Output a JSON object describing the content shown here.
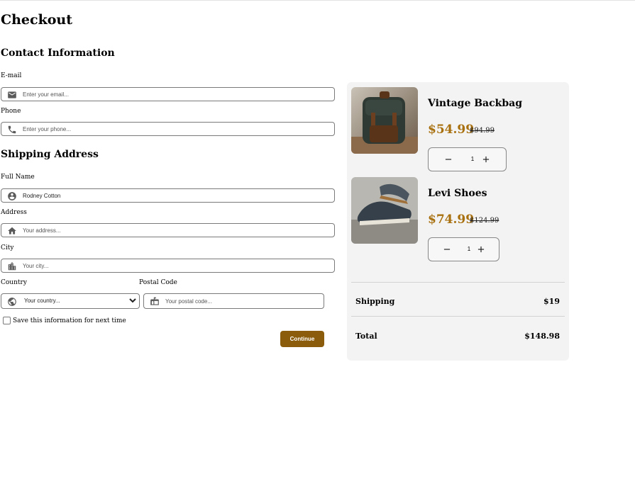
{
  "page": {
    "title": "Checkout"
  },
  "contact": {
    "heading": "Contact Information",
    "email": {
      "label": "E-mail",
      "placeholder": "Enter your email...",
      "value": ""
    },
    "phone": {
      "label": "Phone",
      "placeholder": "Enter your phone...",
      "value": ""
    }
  },
  "shipping": {
    "heading": "Shipping Address",
    "full_name": {
      "label": "Full Name",
      "placeholder": "",
      "value": "Rodney Cotton"
    },
    "address": {
      "label": "Address",
      "placeholder": "Your address...",
      "value": ""
    },
    "city": {
      "label": "City",
      "placeholder": "Your city...",
      "value": ""
    },
    "country": {
      "label": "Country",
      "selected": "Your country..."
    },
    "postal": {
      "label": "Postal Code",
      "placeholder": "Your postal code...",
      "value": ""
    },
    "save_label": "Save this information for next time",
    "continue_label": "Continue"
  },
  "cart": {
    "items": [
      {
        "name": "Vintage Backbag",
        "price": "$54.99",
        "old_price": "$94.99",
        "quantity": "1"
      },
      {
        "name": "Levi Shoes",
        "price": "$74.99",
        "old_price": "$124.99",
        "quantity": "1"
      }
    ],
    "shipping_label": "Shipping",
    "shipping_value": "$19",
    "total_label": "Total",
    "total_value": "$148.98"
  },
  "colors": {
    "accent": "#a8700f",
    "button": "#8a5c0c",
    "card": "#f3f3f3"
  },
  "icons": [
    "mail-icon",
    "phone-icon",
    "account-icon",
    "home-icon",
    "city-icon",
    "globe-icon",
    "mailbox-icon",
    "minus-icon",
    "plus-icon"
  ]
}
